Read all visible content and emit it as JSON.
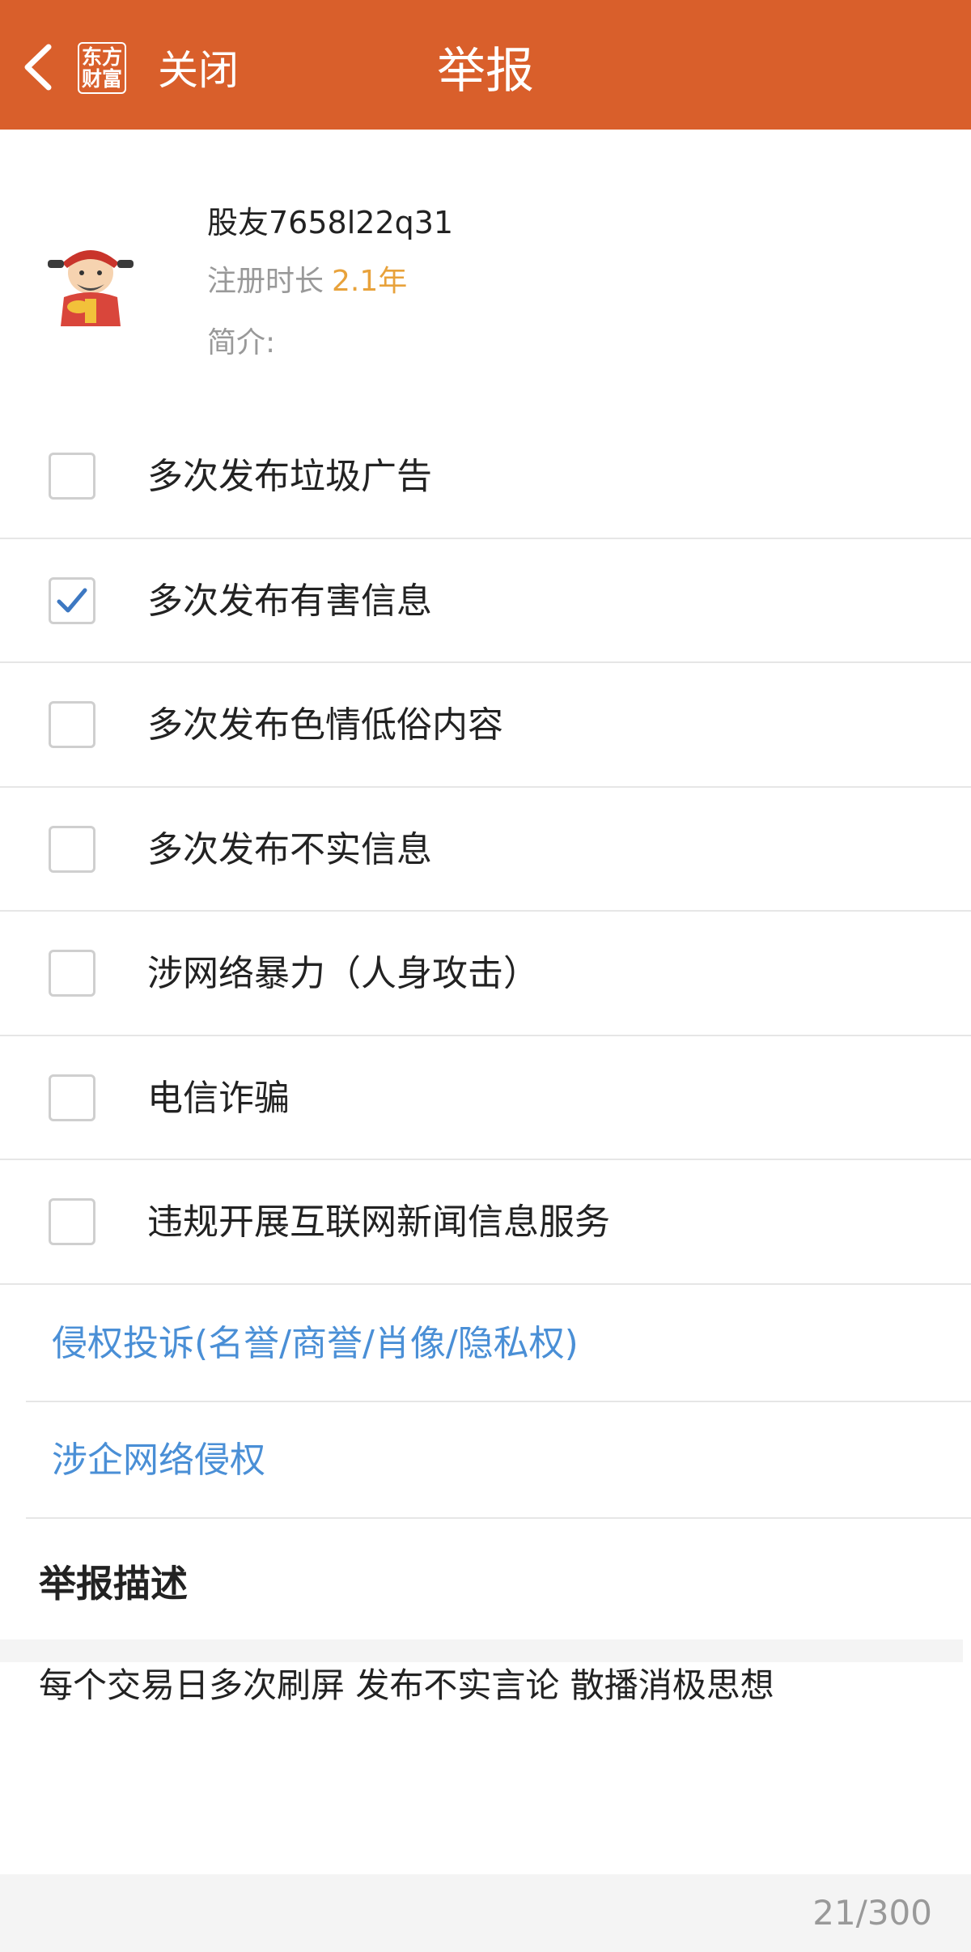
{
  "header": {
    "logo_line1": "东方",
    "logo_line2": "财富",
    "close_label": "关闭",
    "title": "举报",
    "bg_color": "#d95f2b"
  },
  "profile": {
    "username": "股友7658l22q31",
    "reg_label": "注册时长",
    "reg_value": "2.1年",
    "bio_label": "简介:"
  },
  "options": [
    {
      "label": "多次发布垃圾广告",
      "checked": false
    },
    {
      "label": "多次发布有害信息",
      "checked": true
    },
    {
      "label": "多次发布色情低俗内容",
      "checked": false
    },
    {
      "label": "多次发布不实信息",
      "checked": false
    },
    {
      "label": "涉网络暴力（人身攻击）",
      "checked": false
    },
    {
      "label": "电信诈骗",
      "checked": false
    },
    {
      "label": "违规开展互联网新闻信息服务",
      "checked": false
    }
  ],
  "links": [
    {
      "label": "侵权投诉(名誉/商誉/肖像/隐私权)"
    },
    {
      "label": "涉企网络侵权"
    }
  ],
  "description": {
    "heading": "举报描述",
    "text": "每个交易日多次刷屏  发布不实言论  散播消极思想",
    "counter": "21/300"
  }
}
